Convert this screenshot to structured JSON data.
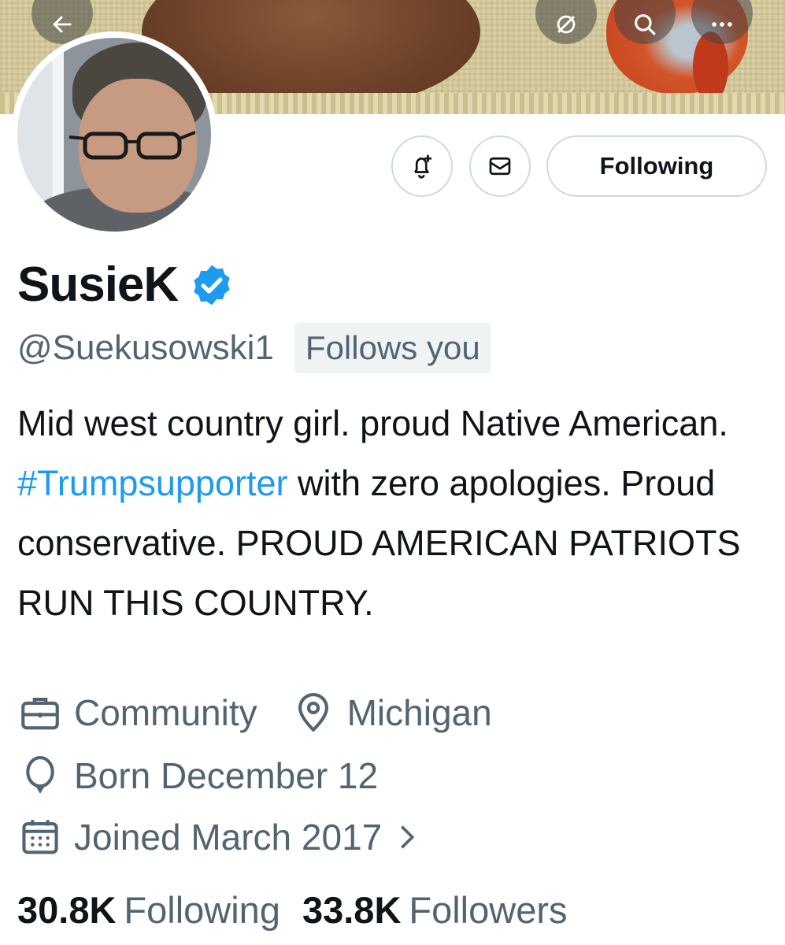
{
  "header": {
    "back_icon": "arrow-left-icon",
    "hide_icon": "eye-slash-icon",
    "search_icon": "search-icon",
    "more_icon": "more-horizontal-icon"
  },
  "actions": {
    "notify_icon": "bell-plus-icon",
    "message_icon": "envelope-icon",
    "follow_label": "Following"
  },
  "profile": {
    "display_name": "SusieK",
    "verified": true,
    "handle": "@Suekusowski1",
    "follows_you": "Follows you",
    "bio_part1": "Mid west country girl. proud Native American. ",
    "bio_hashtag": "#Trumpsupporter",
    "bio_part2": " with zero apologies. Proud conservative. PROUD AMERICAN PATRIOTS RUN THIS COUNTRY.",
    "category": "Community",
    "location": "Michigan",
    "birthday": "Born December 12",
    "joined": "Joined March 2017",
    "following_count": "30.8K",
    "following_label": "Following",
    "followers_count": "33.8K",
    "followers_label": "Followers"
  },
  "colors": {
    "accent": "#1d9bf0",
    "text_primary": "#0f1419",
    "text_secondary": "#536471",
    "border": "#cfd9de",
    "badge_bg": "#eff3f4"
  }
}
